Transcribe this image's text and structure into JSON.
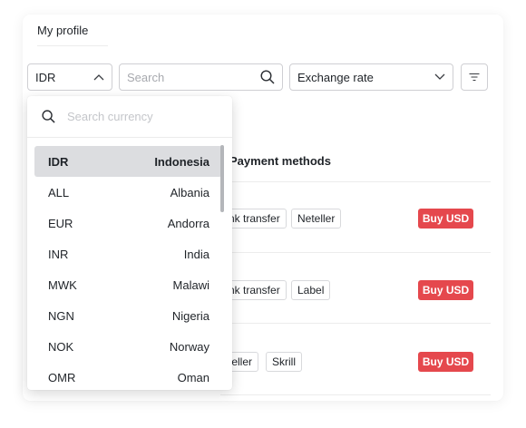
{
  "header": {
    "profile_tab": "My profile"
  },
  "filters": {
    "currency_value": "IDR",
    "search_placeholder": "Search",
    "sort_value": "Exchange rate"
  },
  "table": {
    "payment_methods_header": "Payment methods",
    "rows": [
      {
        "methods": [
          "nk transfer",
          "Neteller"
        ],
        "action": "Buy USD"
      },
      {
        "methods": [
          "nk transfer",
          "Label"
        ],
        "action": "Buy USD"
      },
      {
        "methods": [
          "teller",
          "Skrill"
        ],
        "action": "Buy USD"
      }
    ]
  },
  "dropdown": {
    "search_placeholder": "Search currency",
    "items": [
      {
        "code": "IDR",
        "country": "Indonesia",
        "selected": true
      },
      {
        "code": "ALL",
        "country": "Albania"
      },
      {
        "code": "EUR",
        "country": "Andorra"
      },
      {
        "code": "INR",
        "country": "India"
      },
      {
        "code": "MWK",
        "country": "Malawi"
      },
      {
        "code": "NGN",
        "country": "Nigeria"
      },
      {
        "code": "NOK",
        "country": "Norway"
      },
      {
        "code": "OMR",
        "country": "Oman"
      }
    ]
  },
  "colors": {
    "accent_red": "#e5484d",
    "selected_bg": "#dcdde0"
  },
  "icons": [
    "chevron-up-icon",
    "search-icon",
    "chevron-down-icon",
    "filter-icon",
    "search-icon"
  ]
}
